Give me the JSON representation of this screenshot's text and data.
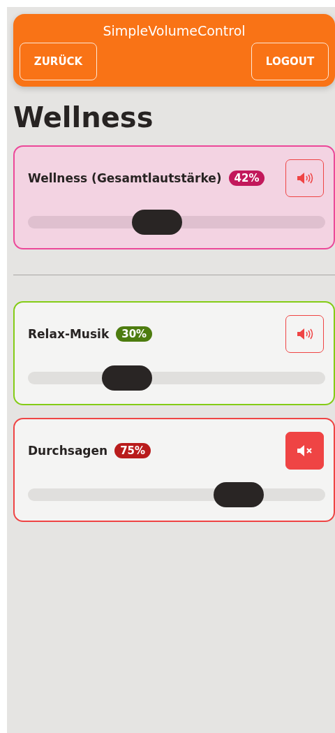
{
  "header": {
    "title": "SimpleVolumeControl",
    "back_button": "ZURÜCK",
    "logout_button": "LOGOUT"
  },
  "page_title": "Wellness",
  "master": {
    "kind": "master",
    "name": "Wellness (Gesamtlautstärke)",
    "badge": {
      "text": "42%",
      "color": "#c2185b"
    },
    "level": 0.42,
    "muted": false,
    "color": "#ec4899"
  },
  "channels": [
    {
      "kind": "channel",
      "name": "Relax-Musik",
      "badge": {
        "text": "30%",
        "color": "#4d7c0f"
      },
      "level": 0.3,
      "muted": false,
      "color": "#84cc16"
    },
    {
      "kind": "channel",
      "name": "Durchsagen",
      "badge": {
        "text": "75%",
        "color": "#b91c1c"
      },
      "level": 0.75,
      "muted": true,
      "color": "#ef4444"
    }
  ]
}
